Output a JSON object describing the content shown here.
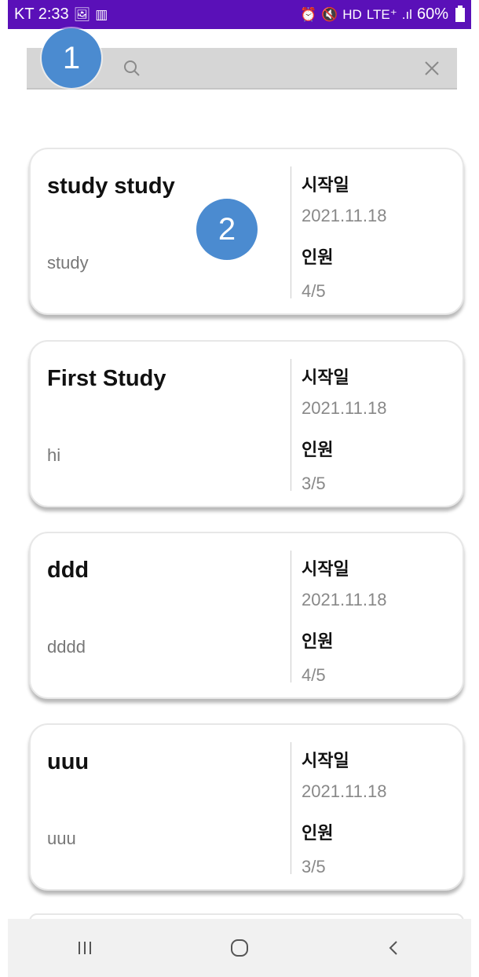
{
  "status_bar": {
    "left_text": "KT 2:33",
    "battery": "60%",
    "network": "LTE⁺"
  },
  "search": {
    "value": "",
    "placeholder": ""
  },
  "markers": [
    "1",
    "2"
  ],
  "cards": [
    {
      "title": "study study",
      "desc": "study",
      "start_label": "시작일",
      "start_value": "2021.11.18",
      "people_label": "인원",
      "people_value": "4/5"
    },
    {
      "title": "First Study",
      "desc": "hi",
      "start_label": "시작일",
      "start_value": "2021.11.18",
      "people_label": "인원",
      "people_value": "3/5"
    },
    {
      "title": "ddd",
      "desc": "dddd",
      "start_label": "시작일",
      "start_value": "2021.11.18",
      "people_label": "인원",
      "people_value": "4/5"
    },
    {
      "title": "uuu",
      "desc": "uuu",
      "start_label": "시작일",
      "start_value": "2021.11.18",
      "people_label": "인원",
      "people_value": "3/5"
    }
  ],
  "colors": {
    "status_bar": "#5a10b8",
    "marker": "#4b8bd0",
    "search_bg": "#d6d6d6",
    "nav_bg": "#f1f1f1"
  },
  "icons": {
    "search": "search-icon",
    "clear": "close-icon",
    "nav_recents": "recent-apps-icon",
    "nav_home": "home-icon",
    "nav_back": "back-icon"
  }
}
